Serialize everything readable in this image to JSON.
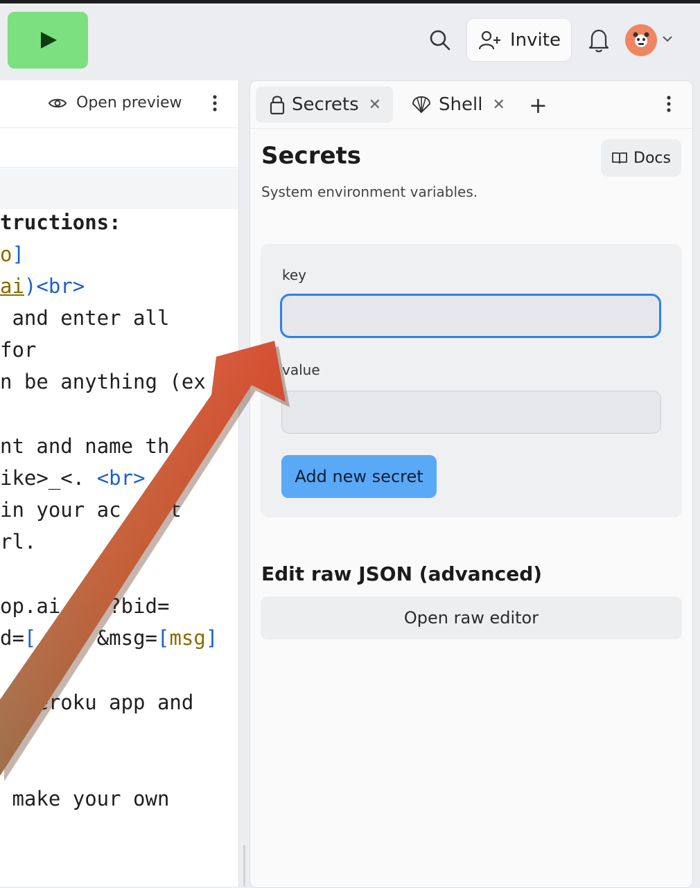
{
  "header": {
    "invite_label": "Invite"
  },
  "left_panel": {
    "open_preview_label": "Open preview",
    "code_lines": {
      "l1": "tructions:",
      "l2a": "o",
      "l2b": "]",
      "l3a": "ai",
      "l3b": ")",
      "l3c": "<br>",
      "l4": " and enter all",
      "l5": "for",
      "l6": "n be anything (ex",
      "l7": "nt and name th",
      "l8a": "ike>_<. ",
      "l8b": "<br>",
      "l9": "in your ac    t",
      "l10": "rl.",
      "l11": "op.ai    ?bid=",
      "l12a": "d=",
      "l12b": "[",
      "l12c": "     &msg=",
      "l12d": "[",
      "l12e": "msg",
      "l12f": "]",
      "l13": "   eroku app and",
      "l14": " make your own"
    }
  },
  "right_panel": {
    "tabs": [
      {
        "label": "Secrets",
        "icon": "lock-icon"
      },
      {
        "label": "Shell",
        "icon": "shell-icon"
      }
    ],
    "title": "Secrets",
    "docs_label": "Docs",
    "subtitle": "System environment variables.",
    "form": {
      "key_label": "key",
      "key_value": "",
      "value_label": "value",
      "value_value": "",
      "add_button": "Add new secret"
    },
    "raw_json_title": "Edit raw JSON (advanced)",
    "raw_editor_button": "Open raw editor"
  },
  "colors": {
    "run_button": "#7be07f",
    "accent_blue": "#2d7ff0",
    "add_button": "#5aa9f7",
    "avatar": "#f08561",
    "arrow": "#e0441c"
  }
}
